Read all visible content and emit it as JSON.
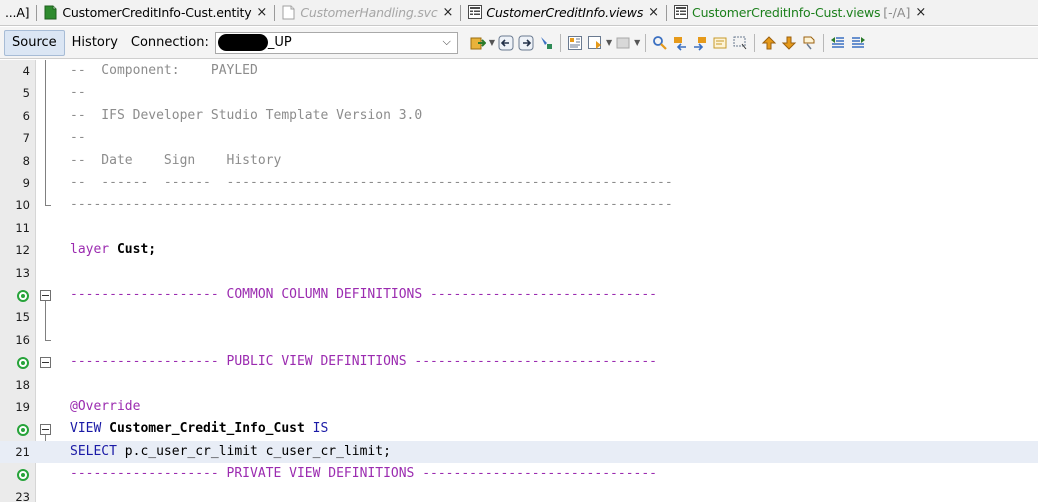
{
  "tabs": [
    {
      "label": "...A]",
      "icon": "none",
      "style": "normal",
      "suffix": "",
      "close": false
    },
    {
      "label": "CustomerCreditInfo-Cust.entity",
      "icon": "entity-file-icon",
      "style": "normal",
      "suffix": "",
      "close": true
    },
    {
      "label": "CustomerHandling.svc",
      "icon": "svc-file-icon",
      "style": "italic-dim",
      "suffix": "",
      "close": true
    },
    {
      "label": "CustomerCreditInfo.views",
      "icon": "views-file-icon",
      "style": "italic",
      "suffix": "",
      "close": true
    },
    {
      "label": "CustomerCreditInfo-Cust.views",
      "icon": "views-file-icon",
      "style": "green",
      "suffix": "[-/A]",
      "close": true
    }
  ],
  "close_glyph": "×",
  "toolbar": {
    "source_label": "Source",
    "history_label": "History",
    "connection_label": "Connection:",
    "connection_value": "_UP",
    "connection_caret": "⌵"
  },
  "colors": {
    "comment": "#8c8c8c",
    "section_comment": "#9b2bb0",
    "keyword": "#1a1aa6",
    "annotation_green": "#27a33a",
    "highlight_line": "#e8edf6"
  },
  "editor": {
    "lines": [
      {
        "num": "4",
        "text": "--  Component:    PAYLED"
      },
      {
        "num": "5",
        "text": "--"
      },
      {
        "num": "6",
        "text": "--  IFS Developer Studio Template Version 3.0"
      },
      {
        "num": "7",
        "text": "--"
      },
      {
        "num": "8",
        "text": "--  Date    Sign    History"
      },
      {
        "num": "9",
        "text": "--  ------  ------  ---------------------------------------------------------"
      },
      {
        "num": "10",
        "text": "-----------------------------------------------------------------------------"
      },
      {
        "num": "11",
        "text": ""
      },
      {
        "num": "12",
        "kw": "layer",
        "rest": " Cust;"
      },
      {
        "num": "13",
        "text": ""
      },
      {
        "num": "",
        "text": "------------------- COMMON COLUMN DEFINITIONS -----------------------------"
      },
      {
        "num": "15",
        "text": ""
      },
      {
        "num": "16",
        "text": ""
      },
      {
        "num": "",
        "text": "------------------- PUBLIC VIEW DEFINITIONS -------------------------------"
      },
      {
        "num": "18",
        "text": ""
      },
      {
        "num": "19",
        "text": "@Override"
      },
      {
        "num": "",
        "kw": "VIEW",
        "name": "Customer_Credit_Info_Cust",
        "kw_end": "IS"
      },
      {
        "num": "21",
        "kw": "SELECT",
        "rest": " p.c_user_cr_limit c_user_cr_limit;"
      },
      {
        "num": "",
        "text": "------------------- PRIVATE VIEW DEFINITIONS ------------------------------"
      },
      {
        "num": "23",
        "text": ""
      }
    ]
  }
}
